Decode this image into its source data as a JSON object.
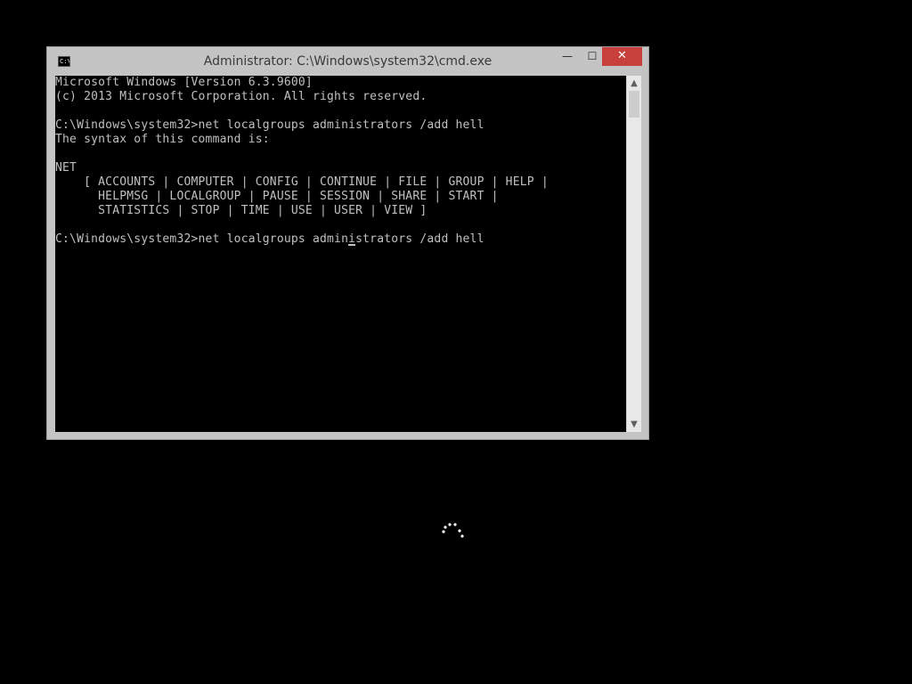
{
  "window": {
    "title": "Administrator: C:\\Windows\\system32\\cmd.exe",
    "icon": "cmd-icon",
    "icon_text": "C:\\.",
    "controls": {
      "minimize": "—",
      "maximize": "☐",
      "close": "✕"
    }
  },
  "console": {
    "lines": [
      "Microsoft Windows [Version 6.3.9600]",
      "(c) 2013 Microsoft Corporation. All rights reserved.",
      "",
      "C:\\Windows\\system32>net localgroups administrators /add hell",
      "The syntax of this command is:",
      "",
      "NET",
      "    [ ACCOUNTS | COMPUTER | CONFIG | CONTINUE | FILE | GROUP | HELP |",
      "      HELPMSG | LOCALGROUP | PAUSE | SESSION | SHARE | START |",
      "      STATISTICS | STOP | TIME | USE | USER | VIEW ]",
      "",
      "C:\\Windows\\system32>net localgroups administrators /add hell"
    ],
    "text_color": "#c0c0c0",
    "background_color": "#000000"
  },
  "scrollbar": {
    "up_arrow": "▲",
    "down_arrow": "▼"
  },
  "colors": {
    "close_button": "#c7403b",
    "window_frame": "#c4c4c4",
    "desktop": "#000000"
  },
  "loading": {
    "icon": "loading-spinner-icon"
  }
}
